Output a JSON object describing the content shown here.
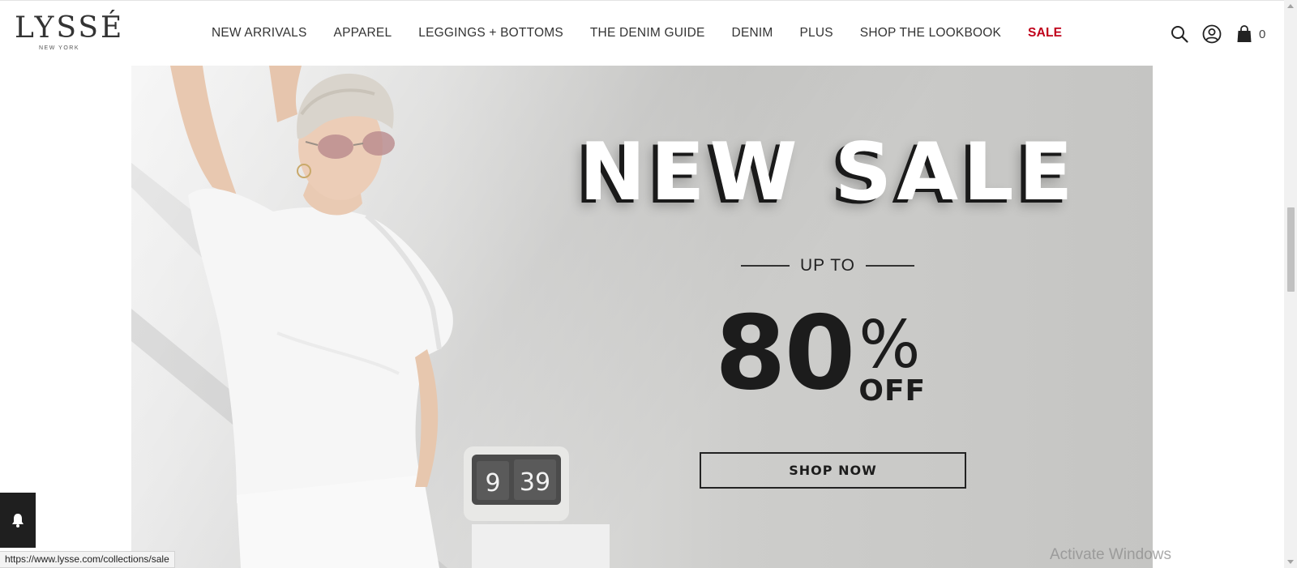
{
  "brand": {
    "name": "LYSSÉ",
    "tagline": "NEW YORK"
  },
  "nav": {
    "items": [
      {
        "label": "NEW ARRIVALS"
      },
      {
        "label": "APPAREL"
      },
      {
        "label": "LEGGINGS + BOTTOMS"
      },
      {
        "label": "THE DENIM GUIDE"
      },
      {
        "label": "DENIM"
      },
      {
        "label": "PLUS"
      },
      {
        "label": "SHOP THE LOOKBOOK"
      },
      {
        "label": "SALE"
      }
    ],
    "sale_color": "#c0001a"
  },
  "header_icons": {
    "search": "search-icon",
    "account": "user-circle-icon",
    "cart": "shopping-bag-icon",
    "cart_count": "0"
  },
  "hero": {
    "headline": "NEW SALE",
    "up_to": "UP TO",
    "discount_number": "80",
    "percent_sign": "%",
    "off": "OFF",
    "button_label": "SHOP NOW",
    "clock_hour": "9",
    "clock_minute": "39"
  },
  "notification_widget": {
    "icon": "bell-icon"
  },
  "status_bar": {
    "url": "https://www.lysse.com/collections/sale"
  },
  "os_watermark": "Activate Windows"
}
